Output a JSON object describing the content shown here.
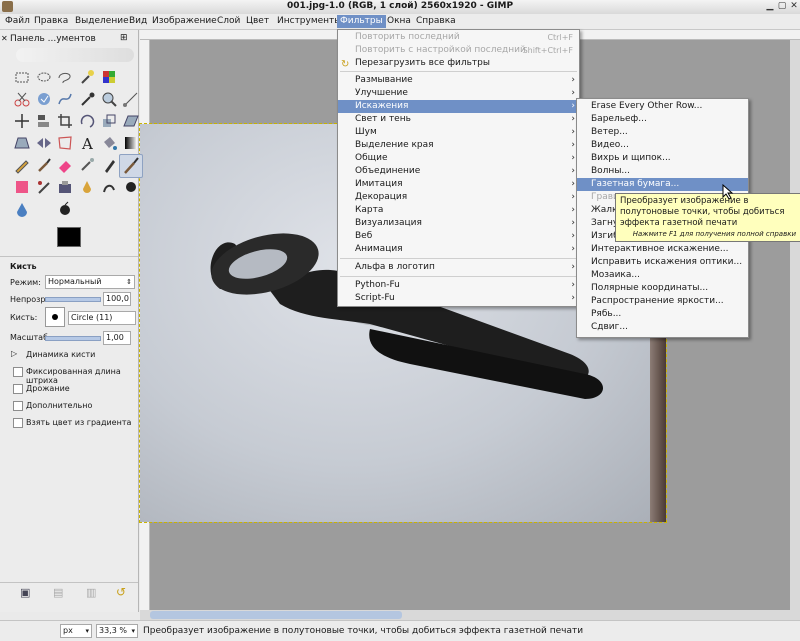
{
  "window": {
    "title": "001.jpg-1.0 (RGB, 1 слой) 2560x1920 - GIMP"
  },
  "menubar": [
    {
      "label": "Файл"
    },
    {
      "label": "Правка"
    },
    {
      "label": "Выделение"
    },
    {
      "label": "Вид"
    },
    {
      "label": "Изображение"
    },
    {
      "label": "Слой"
    },
    {
      "label": "Цвет"
    },
    {
      "label": "Инструменты"
    },
    {
      "label": "Фильтры"
    },
    {
      "label": "Окна"
    },
    {
      "label": "Справка"
    }
  ],
  "toolbox": {
    "title": "Панель ...ументов",
    "tool_options": {
      "title": "Кисть",
      "mode_label": "Режим:",
      "mode_value": "Нормальный",
      "opacity_label": "Непрозр.",
      "opacity_value": "100,0",
      "brush_label": "Кисть:",
      "brush_value": "Circle (11)",
      "scale_label": "Масштаб:",
      "scale_value": "1,00",
      "dynamics_label": "Динамика кисти",
      "options": [
        {
          "label": "Фиксированная длина штриха"
        },
        {
          "label": "Дрожание"
        },
        {
          "label": "Дополнительно"
        },
        {
          "label": "Взять цвет из градиента"
        }
      ]
    }
  },
  "filters_menu": {
    "items": [
      {
        "label": "Повторить последний",
        "shortcut": "Ctrl+F",
        "disabled": true
      },
      {
        "label": "Повторить с настройкой последний",
        "shortcut": "Shift+Ctrl+F",
        "disabled": true
      },
      {
        "label": "Перезагрузить все фильтры"
      },
      {
        "label": "Размывание"
      },
      {
        "label": "Улучшение"
      },
      {
        "label": "Искажения",
        "highlighted": true
      },
      {
        "label": "Свет и тень"
      },
      {
        "label": "Шум"
      },
      {
        "label": "Выделение края"
      },
      {
        "label": "Общие"
      },
      {
        "label": "Объединение"
      },
      {
        "label": "Имитация"
      },
      {
        "label": "Декорация"
      },
      {
        "label": "Карта"
      },
      {
        "label": "Визуализация"
      },
      {
        "label": "Веб"
      },
      {
        "label": "Анимация"
      },
      {
        "label": "Альфа в логотип"
      },
      {
        "label": "Python-Fu"
      },
      {
        "label": "Script-Fu"
      }
    ]
  },
  "distorts_menu": {
    "items": [
      {
        "label": "Erase Every Other Row..."
      },
      {
        "label": "Барельеф..."
      },
      {
        "label": "Ветер..."
      },
      {
        "label": "Видео..."
      },
      {
        "label": "Вихрь и щипок..."
      },
      {
        "label": "Волны..."
      },
      {
        "label": "Газетная бумага...",
        "highlighted": true
      },
      {
        "label": "Грави"
      },
      {
        "label": "Жалю"
      },
      {
        "label": "Загну"
      },
      {
        "label": "Изгиб"
      },
      {
        "label": "Интерактивное искажение..."
      },
      {
        "label": "Исправить искажения оптики..."
      },
      {
        "label": "Мозаика..."
      },
      {
        "label": "Полярные координаты..."
      },
      {
        "label": "Распространение яркости..."
      },
      {
        "label": "Рябь..."
      },
      {
        "label": "Сдвиг..."
      }
    ]
  },
  "tooltip": {
    "text": "Преобразует изображение в полутоновые точки, чтобы добиться эффекта газетной печати",
    "hint": "Нажмите F1 для получения полной справки"
  },
  "statusbar": {
    "unit": "px",
    "zoom": "33,3 %",
    "message": "Преобразует изображение в полутоновые точки, чтобы добиться эффекта газетной печати"
  },
  "colors": {
    "highlight": "#6f90c6",
    "tooltip_bg": "#ffffbd"
  }
}
